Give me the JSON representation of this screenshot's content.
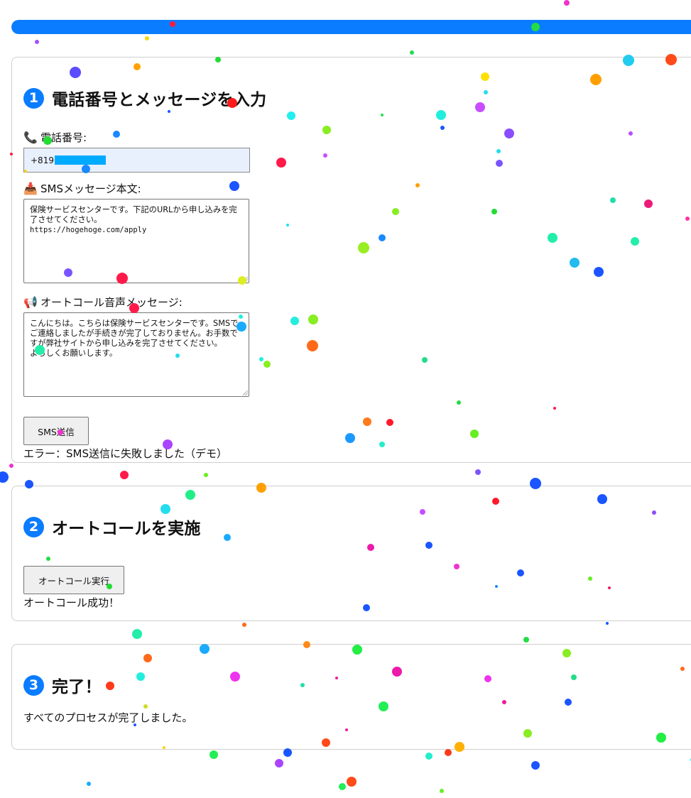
{
  "progress": {
    "value_percent": 100,
    "color": "#0a7cff"
  },
  "steps": [
    {
      "number": "1",
      "title": "電話番号とメッセージを入力",
      "phone_label": "電話番号:",
      "phone_icon": "telephone-icon",
      "phone_value": "+819",
      "sms_label": "SMSメッセージ本文:",
      "sms_icon": "envelope-tray-icon",
      "sms_text_line1": "保険サービスセンターです。下記のURLから申し込みを完了させてください。",
      "sms_url": "https://hogehoge.com/apply",
      "voice_label": "オートコール音声メッセージ:",
      "voice_icon": "megaphone-icon",
      "voice_text": "こんにちは。こちらは保険サービスセンターです。SMSでご連絡しましたが手続きが完了しておりません。お手数ですが弊社サイトから申し込みを完了させてください。\nよろしくお願いします。",
      "button_label": "SMS送信",
      "status_text": "エラー：SMS送信に失敗しました（デモ）"
    },
    {
      "number": "2",
      "title": "オートコールを実施",
      "button_label": "オートコール実行",
      "status_text": "オートコール成功！"
    },
    {
      "number": "3",
      "title": "完了！",
      "body_text": "すべてのプロセスが完了しました。"
    }
  ],
  "colors": {
    "accent": "#0a7cff",
    "mask": "#00aaff"
  }
}
